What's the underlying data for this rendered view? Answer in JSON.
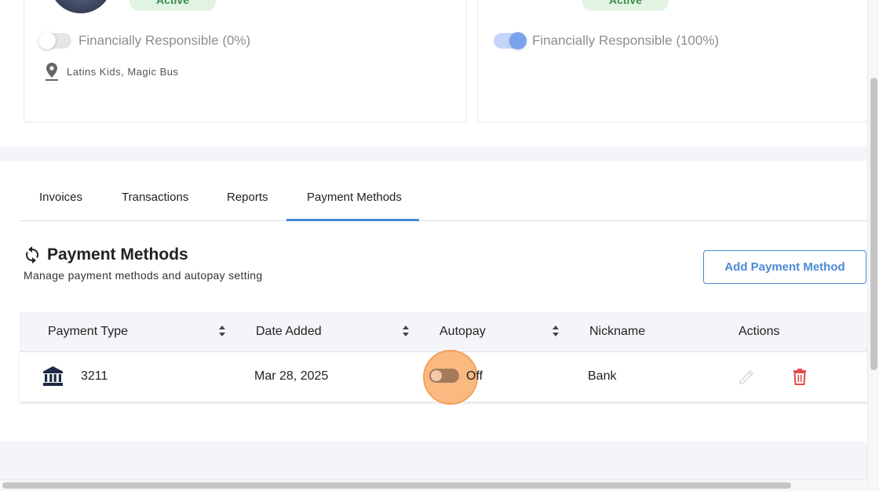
{
  "cards": [
    {
      "status": "Active",
      "financial_label": "Financially Responsible (0%)",
      "financial_on": false,
      "locations": "Latins Kids, Magic Bus"
    },
    {
      "status": "Active",
      "financial_label": "Financially Responsible (100%)",
      "financial_on": true
    }
  ],
  "tabs": [
    {
      "label": "Invoices"
    },
    {
      "label": "Transactions"
    },
    {
      "label": "Reports"
    },
    {
      "label": "Payment Methods",
      "active": true
    }
  ],
  "section": {
    "title": "Payment Methods",
    "description": "Manage payment methods and autopay setting",
    "add_button": "Add Payment Method"
  },
  "table": {
    "headers": {
      "payment_type": "Payment Type",
      "date_added": "Date Added",
      "autopay": "Autopay",
      "nickname": "Nickname",
      "actions": "Actions"
    },
    "rows": [
      {
        "type_icon": "bank-icon",
        "account": "3211",
        "date_added": "Mar 28, 2025",
        "autopay_on": false,
        "autopay_label": "Off",
        "nickname": "Bank"
      }
    ]
  },
  "colors": {
    "accent": "#4a8ad4",
    "active_badge_bg": "#e1f3e3",
    "active_badge_text": "#3c8f48",
    "delete_red": "#e34a4a"
  }
}
